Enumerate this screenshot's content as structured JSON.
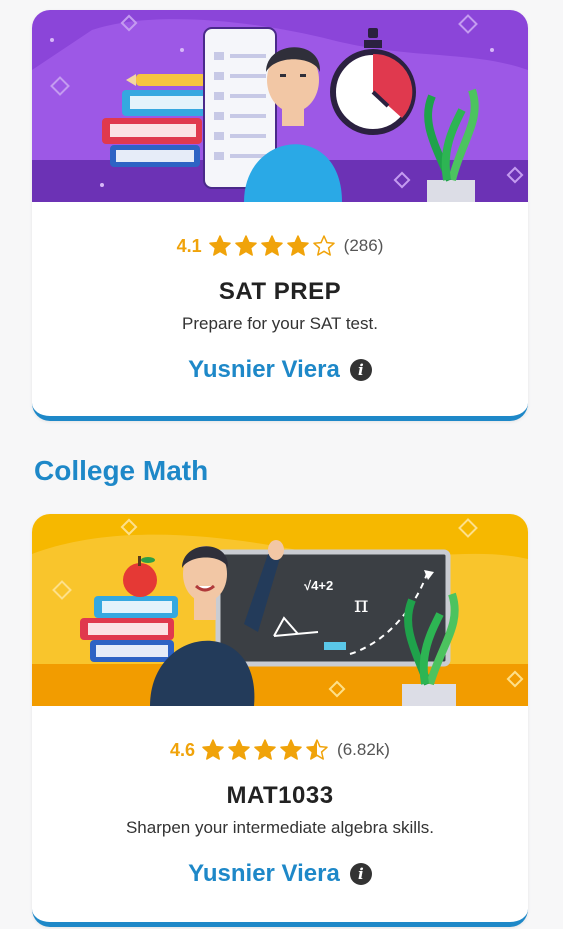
{
  "courses": [
    {
      "rating": "4.1",
      "stars": [
        1,
        1,
        1,
        1,
        0
      ],
      "count": "(286)",
      "title": "SAT PREP",
      "subtitle": "Prepare for your SAT test.",
      "author": "Yusnier Viera",
      "hero_color": "#8b45d9"
    },
    {
      "rating": "4.6",
      "stars": [
        1,
        1,
        1,
        1,
        0.5
      ],
      "count": "(6.82k)",
      "title": "MAT1033",
      "subtitle": "Sharpen your intermediate algebra skills.",
      "author": "Yusnier Viera",
      "hero_color": "#f6b800"
    }
  ],
  "section_heading": "College Math",
  "chalkboard": {
    "formula": "√4+2",
    "pi": "π"
  },
  "icons": {
    "info": "info-icon",
    "star": "star-icon"
  },
  "colors": {
    "accent": "#1e88c8",
    "star": "#f0a30a"
  }
}
